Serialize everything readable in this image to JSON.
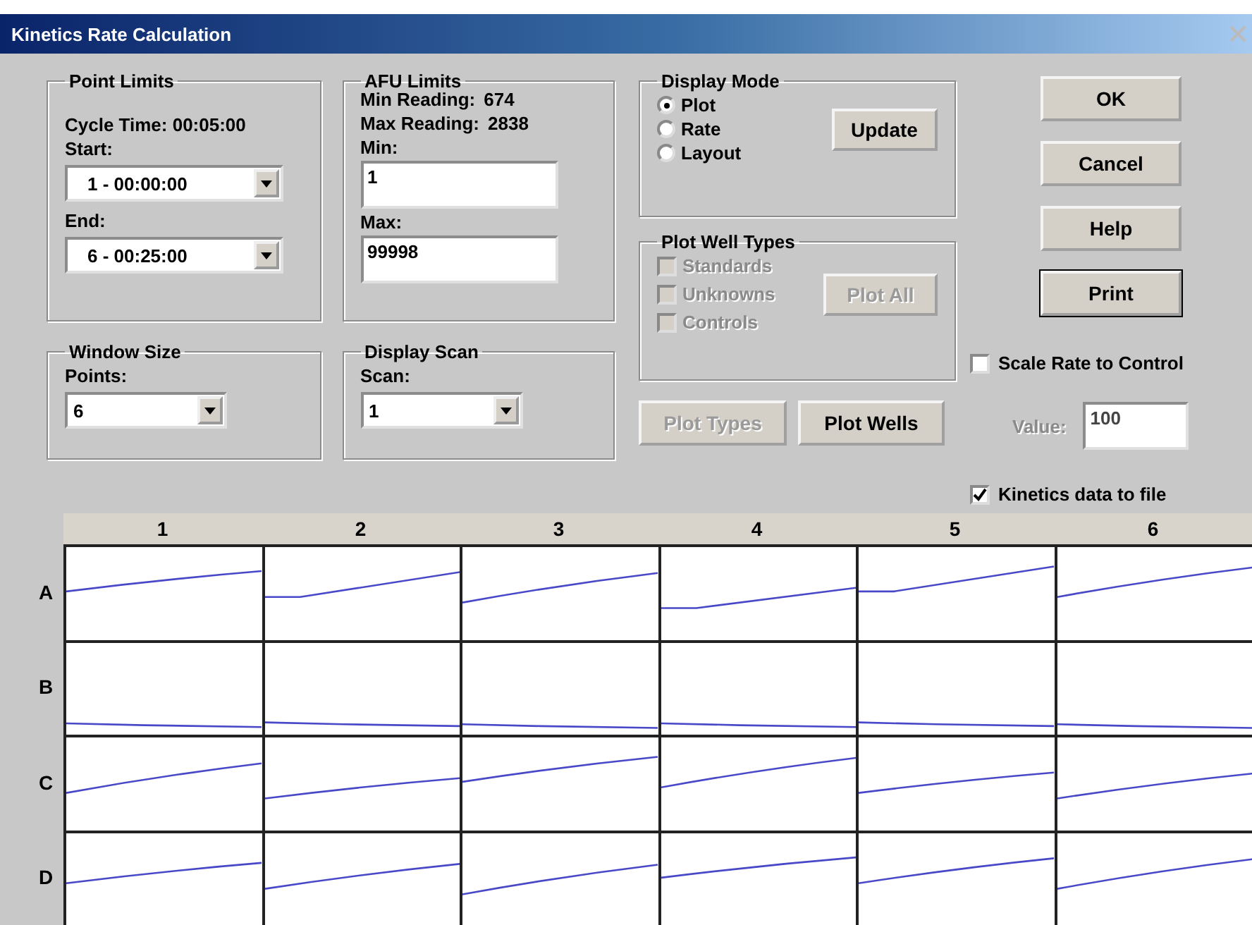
{
  "window": {
    "title": "Kinetics Rate Calculation"
  },
  "point_limits": {
    "title": "Point Limits",
    "cycle_time": "Cycle Time: 00:05:00",
    "start_label": "Start:",
    "start_value": "1 - 00:00:00",
    "end_label": "End:",
    "end_value": "6 - 00:25:00"
  },
  "afu_limits": {
    "title": "AFU Limits",
    "min_reading_label": "Min Reading:",
    "min_reading": "674",
    "max_reading_label": "Max Reading:",
    "max_reading": "2838",
    "min_label": "Min:",
    "min_value": "1",
    "max_label": "Max:",
    "max_value": "99998"
  },
  "window_size": {
    "title": "Window Size",
    "label": "Points:",
    "value": "6"
  },
  "display_scan": {
    "title": "Display Scan",
    "label": "Scan:",
    "value": "1"
  },
  "display_mode": {
    "title": "Display Mode",
    "update_button": "Update",
    "options": [
      {
        "label": "Plot",
        "selected": true
      },
      {
        "label": "Rate",
        "selected": false
      },
      {
        "label": "Layout",
        "selected": false
      }
    ]
  },
  "plot_well_types": {
    "title": "Plot Well Types",
    "plot_all_button": "Plot All",
    "options": [
      {
        "label": "Standards",
        "checked": false,
        "disabled": true
      },
      {
        "label": "Unknowns",
        "checked": false,
        "disabled": true
      },
      {
        "label": "Controls",
        "checked": false,
        "disabled": true
      }
    ]
  },
  "plot_buttons": [
    {
      "label": "Plot Types",
      "disabled": true
    },
    {
      "label": "Plot Wells",
      "disabled": false
    }
  ],
  "dialog_buttons": [
    {
      "label": "OK",
      "default": false
    },
    {
      "label": "Cancel",
      "default": false
    },
    {
      "label": "Help",
      "default": false
    },
    {
      "label": "Print",
      "default": true
    }
  ],
  "scale_rate": {
    "label": "Scale Rate to Control",
    "checked": false,
    "value_label": "Value:",
    "value": "100",
    "disabled": true
  },
  "kinetics_to_file": {
    "label": "Kinetics data to file",
    "checked": true
  },
  "plate": {
    "columns": [
      "1",
      "2",
      "3",
      "4",
      "5",
      "6"
    ],
    "rows": [
      "A",
      "B",
      "C",
      "D"
    ]
  }
}
